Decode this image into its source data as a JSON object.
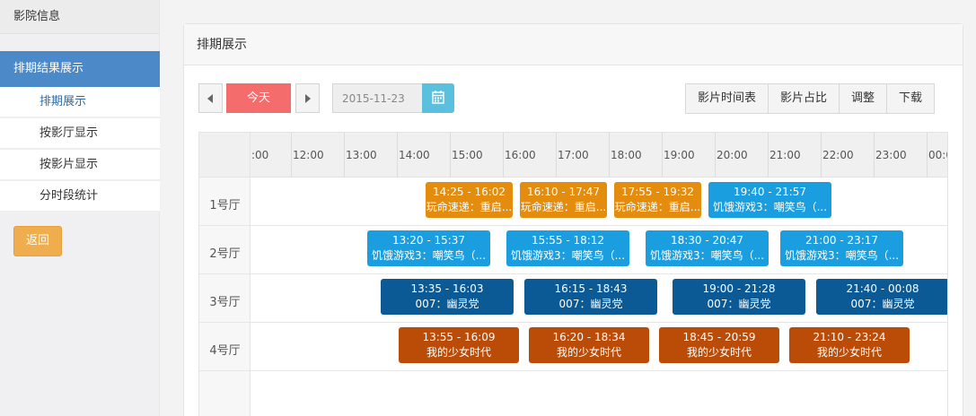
{
  "sidebar": {
    "header": "影院信息",
    "active": "排期结果展示",
    "sub_items": [
      "排期展示",
      "按影厅显示",
      "按影片显示",
      "分时段统计"
    ],
    "back": "返回"
  },
  "panel": {
    "title": "排期展示",
    "today": "今天",
    "date": "2015-11-23",
    "actions": [
      "影片时间表",
      "影片占比",
      "调整",
      "下载"
    ]
  },
  "grid": {
    "hours": [
      ":00",
      "12:00",
      "13:00",
      "14:00",
      "15:00",
      "16:00",
      "17:00",
      "18:00",
      "19:00",
      "20:00",
      "21:00",
      "22:00",
      "23:00",
      "00:0"
    ],
    "halls": [
      "1号厅",
      "2号厅",
      "3号厅",
      "4号厅"
    ],
    "hall1": [
      {
        "time": "14:25 - 16:02",
        "movie": "玩命速递：重启..."
      },
      {
        "time": "16:10 - 17:47",
        "movie": "玩命速递：重启..."
      },
      {
        "time": "17:55 - 19:32",
        "movie": "玩命速递：重启..."
      },
      {
        "time": "19:40 - 21:57",
        "movie": "饥饿游戏3：嘲笑鸟（..."
      }
    ],
    "hall2": [
      {
        "time": "13:20 - 15:37",
        "movie": "饥饿游戏3：嘲笑鸟（..."
      },
      {
        "time": "15:55 - 18:12",
        "movie": "饥饿游戏3：嘲笑鸟（..."
      },
      {
        "time": "18:30 - 20:47",
        "movie": "饥饿游戏3：嘲笑鸟（..."
      },
      {
        "time": "21:00 - 23:17",
        "movie": "饥饿游戏3：嘲笑鸟（..."
      }
    ],
    "hall3": [
      {
        "time": "13:35 - 16:03",
        "movie": "007：幽灵党"
      },
      {
        "time": "16:15 - 18:43",
        "movie": "007：幽灵党"
      },
      {
        "time": "19:00 - 21:28",
        "movie": "007：幽灵党"
      },
      {
        "time": "21:40 - 00:08",
        "movie": "007：幽灵党"
      }
    ],
    "hall4": [
      {
        "time": "13:55 - 16:09",
        "movie": "我的少女时代"
      },
      {
        "time": "16:20 - 18:34",
        "movie": "我的少女时代"
      },
      {
        "time": "18:45 - 20:59",
        "movie": "我的少女时代"
      },
      {
        "time": "21:10 - 23:24",
        "movie": "我的少女时代"
      }
    ]
  },
  "colors": {
    "hall1": "#e48c0e",
    "hall2": "#1b9ee0",
    "hall3": "#0b5a96",
    "hall4": "#bb4c08",
    "sidebar_active": "#4b89c8",
    "today_button": "#f46c6c",
    "back_button": "#f0ad4e"
  }
}
